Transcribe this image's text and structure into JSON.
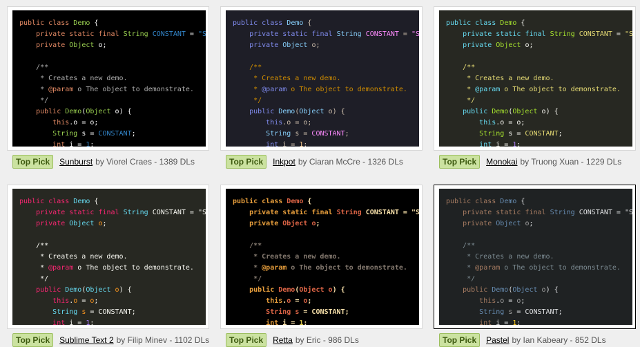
{
  "badge_label": "Top Pick",
  "code_lines": [
    [
      "public",
      " ",
      "class",
      " ",
      "Demo",
      " {"
    ],
    [
      "    ",
      "private",
      " ",
      "static",
      " ",
      "final",
      " ",
      "String",
      " ",
      "CONSTANT",
      " = ",
      "\"S"
    ],
    [
      "    ",
      "private",
      " ",
      "Object",
      " ",
      "o",
      ";"
    ],
    [
      ""
    ],
    [
      "    ",
      "/**"
    ],
    [
      "     * Creates a new demo."
    ],
    [
      "     * ",
      "@param",
      " o The object to demonstrate."
    ],
    [
      "     */"
    ],
    [
      "    ",
      "public",
      " ",
      "Demo",
      "(",
      "Object",
      " ",
      "o",
      ") {"
    ],
    [
      "        ",
      "this",
      ".",
      "o",
      " = ",
      "o",
      ";"
    ],
    [
      "        ",
      "String",
      " ",
      "s",
      " = ",
      "CONSTANT",
      ";"
    ],
    [
      "        ",
      "int",
      " i = ",
      "1",
      ";"
    ]
  ],
  "themes": [
    {
      "name": "Sunburst",
      "author_text": "by Viorel Craes - 1389 DLs",
      "bg": "#000000",
      "fg": "#f8f8f8",
      "keyword": "#e28964",
      "type": "#99cf50",
      "constant": "#3387cc",
      "comment": "#aeaeae",
      "number": "#3387cc",
      "field": "#ffffff",
      "bold": false,
      "selected": false
    },
    {
      "name": "Inkpot",
      "author_text": "by Ciaran McCre - 1326 DLs",
      "bg": "#1e1e27",
      "fg": "#cfbfad",
      "keyword": "#808bed",
      "type": "#87cefa",
      "constant": "#ff8bff",
      "comment": "#cd8b00",
      "number": "#ffcd8b",
      "field": "#cfbfad",
      "bold": false,
      "selected": false
    },
    {
      "name": "Monokai",
      "author_text": "by Truong Xuan - 1229 DLs",
      "bg": "#272822",
      "fg": "#f8f8f2",
      "keyword": "#66d9ef",
      "type": "#a6e22e",
      "constant": "#e6db74",
      "comment": "#e6db74",
      "number": "#ae81ff",
      "field": "#f8f8f2",
      "bold": false,
      "selected": false
    },
    {
      "name": "Sublime Text 2",
      "author_text": "by Filip Minev - 1102 DLs",
      "bg": "#272822",
      "fg": "#f8f8f2",
      "keyword": "#f92672",
      "type": "#66d9ef",
      "constant": "#f8f8f2",
      "comment": "#f8f8f2",
      "number": "#ae81ff",
      "field": "#fd971f",
      "bold": false,
      "selected": false
    },
    {
      "name": "Retta",
      "author_text": "by Eric - 986 DLs",
      "bg": "#000000",
      "fg": "#f8e1aa",
      "keyword": "#e79e3c",
      "type": "#de6546",
      "constant": "#f8e1aa",
      "comment": "#83786e",
      "number": "#d6c248",
      "field": "#de6546",
      "bold": true,
      "selected": false
    },
    {
      "name": "Pastel",
      "author_text": "by Ian Kabeary - 852 DLs",
      "bg": "#1f2223",
      "fg": "#e0e2e4",
      "keyword": "#a57b61",
      "type": "#678cb1",
      "constant": "#e0e2e4",
      "comment": "#7d8c93",
      "number": "#ffcd22",
      "field": "#a0a0a0",
      "bold": false,
      "selected": true
    }
  ]
}
